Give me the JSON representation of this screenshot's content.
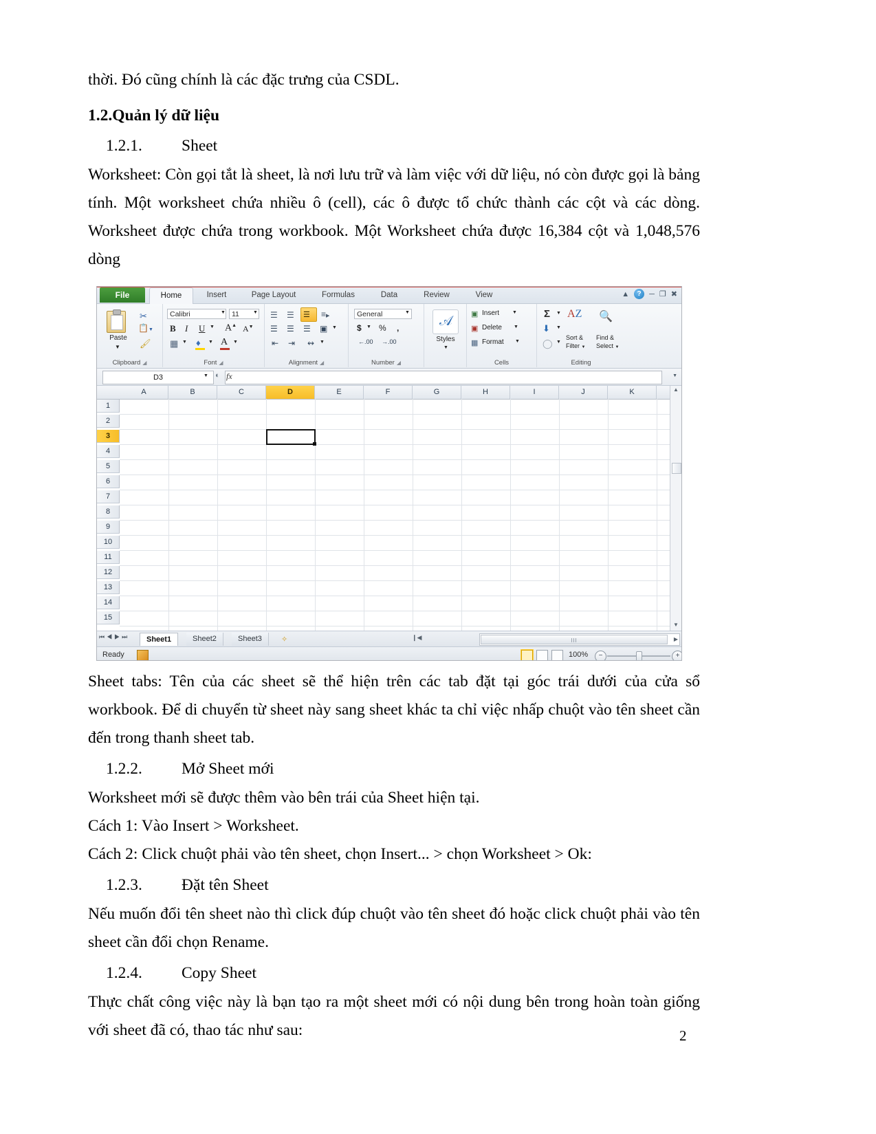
{
  "document": {
    "paragraphs": {
      "p_intro": "thời. Đó cũng chính là các đặc trưng của CSDL.",
      "h_1_2": "1.2.Quản lý dữ liệu",
      "h_1_2_1_num": "1.2.1.",
      "h_1_2_1_text": "Sheet",
      "p_worksheet": "Worksheet: Còn gọi tắt là sheet, là nơi lưu trữ và làm việc với dữ liệu, nó còn được gọi là bảng tính. Một worksheet chứa nhiều ô (cell), các ô được tổ chức thành các cột và các dòng. Worksheet được chứa trong workbook. Một Worksheet chứa được 16,384 cột và 1,048,576 dòng",
      "p_sheettabs": "Sheet tabs: Tên của các sheet sẽ thể hiện trên các tab đặt tại góc trái dưới của cửa sổ workbook. Để di chuyển từ sheet này sang sheet khác ta chỉ việc nhấp chuột vào tên sheet cần đến trong thanh sheet tab.",
      "h_1_2_2_num": "1.2.2.",
      "h_1_2_2_text": "Mở Sheet mới",
      "p_newsheet": "Worksheet mới sẽ được thêm vào bên trái của Sheet hiện tại.",
      "p_cach1": "Cách 1: Vào Insert > Worksheet.",
      "p_cach2": "Cách 2: Click chuột phải vào tên sheet, chọn Insert... > chọn Worksheet > Ok:",
      "h_1_2_3_num": "1.2.3.",
      "h_1_2_3_text": "Đặt tên Sheet",
      "p_rename": "Nếu muốn đổi tên sheet nào thì click đúp chuột vào tên sheet đó hoặc click chuột phải vào tên sheet cần đổi chọn Rename.",
      "h_1_2_4_num": "1.2.4.",
      "h_1_2_4_text": "Copy Sheet",
      "p_copy": "Thực chất công việc này là bạn tạo ra một sheet mới có nội dung bên trong hoàn toàn giống với sheet đã có, thao tác như sau:"
    },
    "page_number": "2"
  },
  "excel": {
    "file_tab": "File",
    "ribbon_tabs": [
      {
        "label": "Home",
        "active": true
      },
      {
        "label": "Insert",
        "active": false
      },
      {
        "label": "Page Layout",
        "active": false
      },
      {
        "label": "Formulas",
        "active": false
      },
      {
        "label": "Data",
        "active": false
      },
      {
        "label": "Review",
        "active": false
      },
      {
        "label": "View",
        "active": false
      }
    ],
    "window_controls": {
      "collapse_ribbon": "collapse-ribbon-icon",
      "help": "?",
      "minimize": "minimize-icon",
      "restore": "restore-icon",
      "close": "close-icon"
    },
    "groups": {
      "clipboard": {
        "label": "Clipboard",
        "paste_label": "Paste",
        "cut_icon": "scissors-icon",
        "copy_icon": "copy-icon",
        "format_painter_icon": "format-painter-icon",
        "dialog_launcher": "dialog-launcher-icon"
      },
      "font": {
        "label": "Font",
        "font_name": "Calibri",
        "font_size": "11",
        "bold": "B",
        "italic": "I",
        "underline": "U",
        "grow_font": "A",
        "shrink_font": "A",
        "borders_icon": "borders-icon",
        "fill_color_icon": "fill-color-icon",
        "font_color_icon": "font-color-icon",
        "dialog_launcher": "dialog-launcher-icon"
      },
      "alignment": {
        "label": "Alignment",
        "align_top_icon": "align-top-icon",
        "align_middle_icon": "align-middle-icon",
        "align_bottom_icon": "align-bottom-icon",
        "orientation_icon": "orientation-icon",
        "align_left_icon": "align-left-icon",
        "align_center_icon": "align-center-icon",
        "align_right_icon": "align-right-icon",
        "merge_center_icon": "merge-and-center-icon",
        "decrease_indent_icon": "decrease-indent-icon",
        "increase_indent_icon": "increase-indent-icon",
        "wrap_text_icon": "wrap-text-icon",
        "dialog_launcher": "dialog-launcher-icon"
      },
      "number": {
        "label": "Number",
        "format_value": "General",
        "currency": "$",
        "percent": "%",
        "comma": ",",
        "increase_decimal": ".00",
        "decrease_decimal": ".00",
        "dialog_launcher": "dialog-launcher-icon"
      },
      "styles": {
        "label": "",
        "styles_label": "Styles",
        "styles_icon": "styles-icon"
      },
      "cells": {
        "label": "Cells",
        "insert_label": "Insert",
        "delete_label": "Delete",
        "format_label": "Format"
      },
      "editing": {
        "label": "Editing",
        "autosum": "Σ",
        "fill_icon": "fill-down-icon",
        "clear_icon": "eraser-icon",
        "sort_filter_line1": "Sort &",
        "sort_filter_line2": "Filter",
        "find_select_line1": "Find &",
        "find_select_line2": "Select"
      }
    },
    "formula_bar": {
      "name_box": "D3",
      "fx_label": "fx",
      "formula_value": ""
    },
    "grid": {
      "columns": [
        "A",
        "B",
        "C",
        "D",
        "E",
        "F",
        "G",
        "H",
        "I",
        "J",
        "K"
      ],
      "selected_column": "D",
      "rows": [
        "1",
        "2",
        "3",
        "4",
        "5",
        "6",
        "7",
        "8",
        "9",
        "10",
        "11",
        "12",
        "13",
        "14",
        "15"
      ],
      "selected_row": "3",
      "active_cell": "D3"
    },
    "sheet_tabs": [
      {
        "label": "Sheet1",
        "active": true
      },
      {
        "label": "Sheet2",
        "active": false
      },
      {
        "label": "Sheet3",
        "active": false
      }
    ],
    "insert_sheet_icon": "insert-worksheet-icon",
    "status_bar": {
      "status_text": "Ready",
      "macro_icon": "record-macro-icon",
      "view_normal": "normal-view-icon",
      "view_page_layout": "page-layout-view-icon",
      "view_page_break": "page-break-preview-icon",
      "zoom_level": "100%",
      "zoom_out": "−",
      "zoom_in": "+"
    }
  }
}
